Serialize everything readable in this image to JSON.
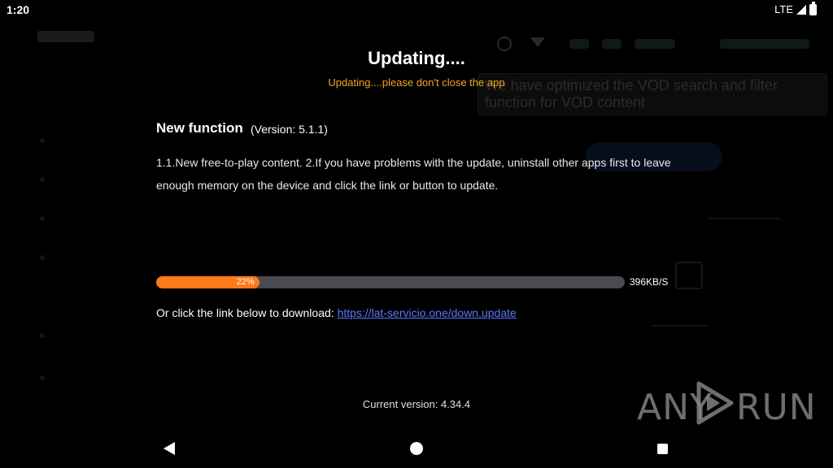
{
  "status_bar": {
    "time": "1:20",
    "network": "LTE"
  },
  "background_app": {
    "tooltip_text": "We have optimized the VOD search and filter function for VOD content"
  },
  "dialog": {
    "title": "Updating....",
    "subtitle": "Updating....please don't close the app",
    "function_heading": "New function",
    "version_text": "(Version: 5.1.1)",
    "description": "1.1.New free-to-play content. 2.If you have problems with the update, uninstall other apps first to leave enough memory on the device and click the link or button to update.",
    "progress": {
      "percent": 22,
      "label": "22%",
      "speed": "396KB/S",
      "fill_color": "#ff7a1a",
      "track_color": "#4a4a52"
    },
    "download_prompt": "Or click the link below to download:",
    "download_link": "https://lat-servicio.one/down.update",
    "current_version": "Current version: 4.34.4"
  },
  "watermark": {
    "text_left": "ANY",
    "text_right": "RUN"
  },
  "nav_bar": {
    "icons": [
      "back-icon",
      "home-icon",
      "recent-apps-icon"
    ]
  },
  "colors": {
    "accent_orange": "#f5a623",
    "link_blue": "#5a78ff"
  }
}
